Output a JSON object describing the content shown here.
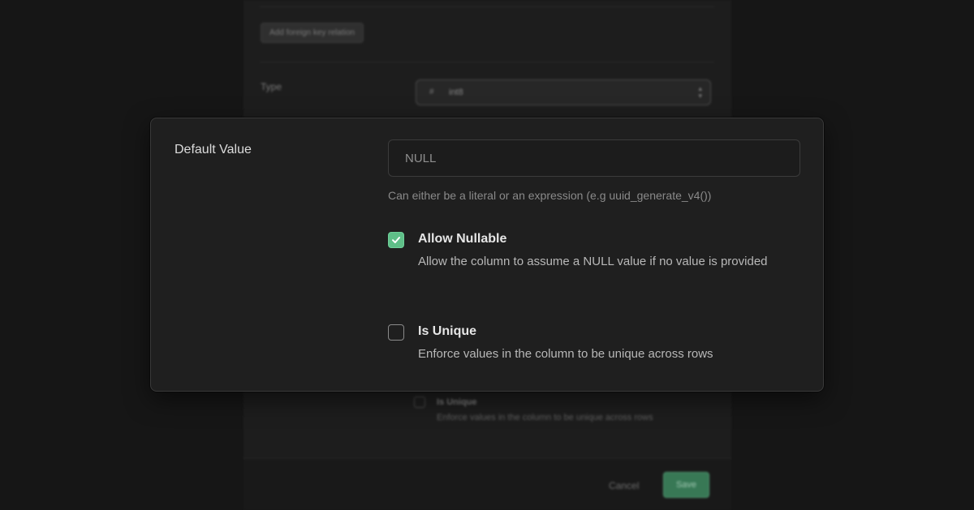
{
  "background": {
    "foreign_key_button": "Add foreign key relation",
    "type_label": "Type",
    "type_icon": "#",
    "type_value": "int8",
    "unique_title": "Is Unique",
    "unique_description": "Enforce values in the column to be unique across rows",
    "cancel_label": "Cancel",
    "save_label": "Save"
  },
  "card": {
    "default_value_label": "Default Value",
    "default_value_input": "",
    "default_value_placeholder": "NULL",
    "helper_text": "Can either be a literal or an expression (e.g uuid_generate_v4())",
    "options": [
      {
        "title": "Allow Nullable",
        "description": "Allow the column to assume a NULL value if no value is provided",
        "checked": true
      },
      {
        "title": "Is Unique",
        "description": "Enforce values in the column to be unique across rows",
        "checked": false
      }
    ]
  },
  "colors": {
    "accent_green": "#5fbf88",
    "panel_background": "#1f1f1f",
    "page_background": "#161616"
  }
}
